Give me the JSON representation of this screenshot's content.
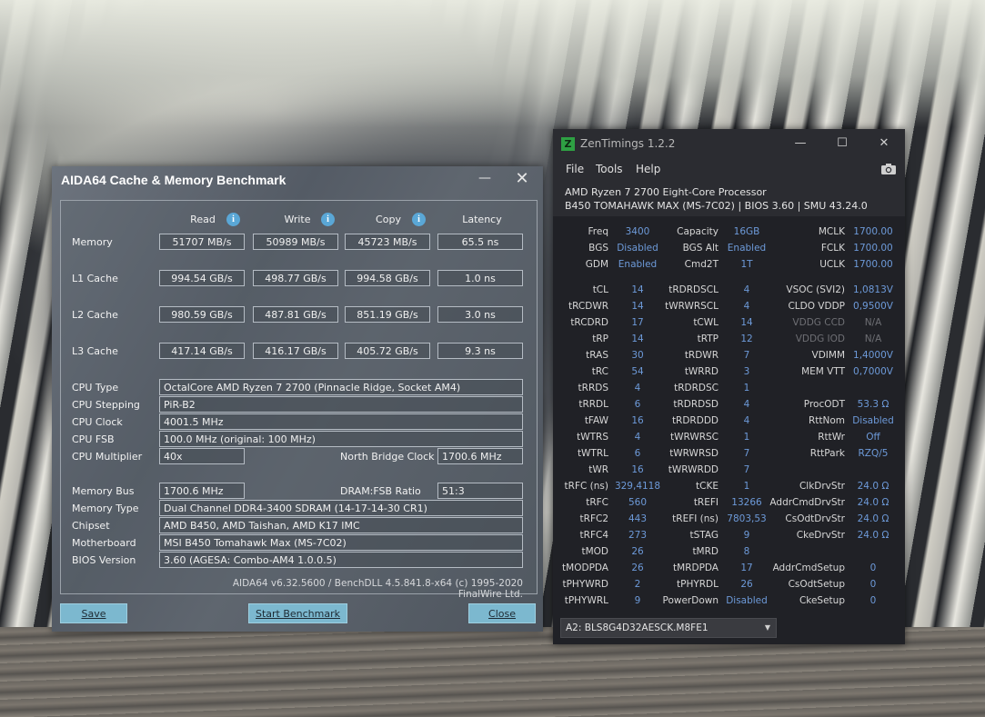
{
  "aida": {
    "title": "AIDA64 Cache & Memory Benchmark",
    "headers": {
      "read": "Read",
      "write": "Write",
      "copy": "Copy",
      "latency": "Latency"
    },
    "bench_rows": [
      {
        "label": "Memory",
        "read": "51707 MB/s",
        "write": "50989 MB/s",
        "copy": "45723 MB/s",
        "latency": "65.5 ns"
      },
      {
        "label": "L1 Cache",
        "read": "994.54 GB/s",
        "write": "498.77 GB/s",
        "copy": "994.58 GB/s",
        "latency": "1.0 ns"
      },
      {
        "label": "L2 Cache",
        "read": "980.59 GB/s",
        "write": "487.81 GB/s",
        "copy": "851.19 GB/s",
        "latency": "3.0 ns"
      },
      {
        "label": "L3 Cache",
        "read": "417.14 GB/s",
        "write": "416.17 GB/s",
        "copy": "405.72 GB/s",
        "latency": "9.3 ns"
      }
    ],
    "cpu": {
      "type_label": "CPU Type",
      "type": "OctalCore AMD Ryzen 7 2700  (Pinnacle Ridge, Socket AM4)",
      "stepping_label": "CPU Stepping",
      "stepping": "PiR-B2",
      "clock_label": "CPU Clock",
      "clock": "4001.5 MHz",
      "fsb_label": "CPU FSB",
      "fsb": "100.0 MHz  (original: 100 MHz)",
      "mult_label": "CPU Multiplier",
      "mult": "40x",
      "nb_label": "North Bridge Clock",
      "nb": "1700.6 MHz"
    },
    "mem": {
      "bus_label": "Memory Bus",
      "bus": "1700.6 MHz",
      "ratio_label": "DRAM:FSB Ratio",
      "ratio": "51:3",
      "type_label": "Memory Type",
      "type": "Dual Channel DDR4-3400 SDRAM  (14-17-14-30 CR1)",
      "chipset_label": "Chipset",
      "chipset": "AMD B450, AMD Taishan, AMD K17 IMC",
      "mobo_label": "Motherboard",
      "mobo": "MSI B450 Tomahawk Max (MS-7C02)",
      "bios_label": "BIOS Version",
      "bios": "3.60  (AGESA: Combo-AM4 1.0.0.5)"
    },
    "footer": "AIDA64 v6.32.5600 / BenchDLL 4.5.841.8-x64  (c) 1995-2020 FinalWire Ltd.",
    "buttons": {
      "save": "Save",
      "start": "Start Benchmark",
      "close": "Close"
    }
  },
  "zen": {
    "title": "ZenTimings 1.2.2",
    "logo": "Z",
    "menu": {
      "file": "File",
      "tools": "Tools",
      "help": "Help"
    },
    "cpu_line": "AMD Ryzen 7 2700 Eight-Core Processor",
    "board_line": "B450 TOMAHAWK MAX (MS-7C02) | BIOS 3.60 | SMU 43.24.0",
    "col1": [
      {
        "k": "Freq",
        "v": "3400"
      },
      {
        "k": "BGS",
        "v": "Disabled"
      },
      {
        "k": "GDM",
        "v": "Enabled"
      },
      {
        "k": "tCL",
        "v": "14"
      },
      {
        "k": "tRCDWR",
        "v": "14"
      },
      {
        "k": "tRCDRD",
        "v": "17"
      },
      {
        "k": "tRP",
        "v": "14"
      },
      {
        "k": "tRAS",
        "v": "30"
      },
      {
        "k": "tRC",
        "v": "54"
      },
      {
        "k": "tRRDS",
        "v": "4"
      },
      {
        "k": "tRRDL",
        "v": "6"
      },
      {
        "k": "tFAW",
        "v": "16"
      },
      {
        "k": "tWTRS",
        "v": "4"
      },
      {
        "k": "tWTRL",
        "v": "6"
      },
      {
        "k": "tWR",
        "v": "16"
      },
      {
        "k": "tRFC (ns)",
        "v": "329,4118"
      },
      {
        "k": "tRFC",
        "v": "560"
      },
      {
        "k": "tRFC2",
        "v": "443"
      },
      {
        "k": "tRFC4",
        "v": "273"
      },
      {
        "k": "tMOD",
        "v": "26"
      },
      {
        "k": "tMODPDA",
        "v": "26"
      },
      {
        "k": "tPHYWRD",
        "v": "2"
      },
      {
        "k": "tPHYWRL",
        "v": "9"
      }
    ],
    "col2": [
      {
        "k": "Capacity",
        "v": "16GB"
      },
      {
        "k": "BGS Alt",
        "v": "Enabled"
      },
      {
        "k": "Cmd2T",
        "v": "1T"
      },
      {
        "k": "tRDRDSCL",
        "v": "4"
      },
      {
        "k": "tWRWRSCL",
        "v": "4"
      },
      {
        "k": "tCWL",
        "v": "14"
      },
      {
        "k": "tRTP",
        "v": "12"
      },
      {
        "k": "tRDWR",
        "v": "7"
      },
      {
        "k": "tWRRD",
        "v": "3"
      },
      {
        "k": "tRDRDSC",
        "v": "1"
      },
      {
        "k": "tRDRDSD",
        "v": "4"
      },
      {
        "k": "tRDRDDD",
        "v": "4"
      },
      {
        "k": "tWRWRSC",
        "v": "1"
      },
      {
        "k": "tWRWRSD",
        "v": "7"
      },
      {
        "k": "tWRWRDD",
        "v": "7"
      },
      {
        "k": "tCKE",
        "v": "1"
      },
      {
        "k": "tREFI",
        "v": "13266"
      },
      {
        "k": "tREFI (ns)",
        "v": "7803,53"
      },
      {
        "k": "tSTAG",
        "v": "9"
      },
      {
        "k": "tMRD",
        "v": "8"
      },
      {
        "k": "tMRDPDA",
        "v": "17"
      },
      {
        "k": "tPHYRDL",
        "v": "26"
      },
      {
        "k": "PowerDown",
        "v": "Disabled"
      }
    ],
    "col3": [
      {
        "k": "MCLK",
        "v": "1700.00"
      },
      {
        "k": "FCLK",
        "v": "1700.00"
      },
      {
        "k": "UCLK",
        "v": "1700.00"
      },
      {
        "k": "VSOC (SVI2)",
        "v": "1,0813V"
      },
      {
        "k": "CLDO VDDP",
        "v": "0,9500V"
      },
      {
        "k": "VDDG CCD",
        "v": "N/A"
      },
      {
        "k": "VDDG IOD",
        "v": "N/A"
      },
      {
        "k": "VDIMM",
        "v": "1,4000V"
      },
      {
        "k": "MEM VTT",
        "v": "0,7000V"
      },
      {
        "k": "",
        "v": ""
      },
      {
        "k": "ProcODT",
        "v": "53.3 Ω"
      },
      {
        "k": "RttNom",
        "v": "Disabled"
      },
      {
        "k": "RttWr",
        "v": "Off"
      },
      {
        "k": "RttPark",
        "v": "RZQ/5"
      },
      {
        "k": "",
        "v": ""
      },
      {
        "k": "ClkDrvStr",
        "v": "24.0 Ω"
      },
      {
        "k": "AddrCmdDrvStr",
        "v": "24.0 Ω"
      },
      {
        "k": "CsOdtDrvStr",
        "v": "24.0 Ω"
      },
      {
        "k": "CkeDrvStr",
        "v": "24.0 Ω"
      },
      {
        "k": "",
        "v": ""
      },
      {
        "k": "AddrCmdSetup",
        "v": "0"
      },
      {
        "k": "CsOdtSetup",
        "v": "0"
      },
      {
        "k": "CkeSetup",
        "v": "0"
      }
    ],
    "profile": "A2: BLS8G4D32AESCK.M8FE1"
  }
}
